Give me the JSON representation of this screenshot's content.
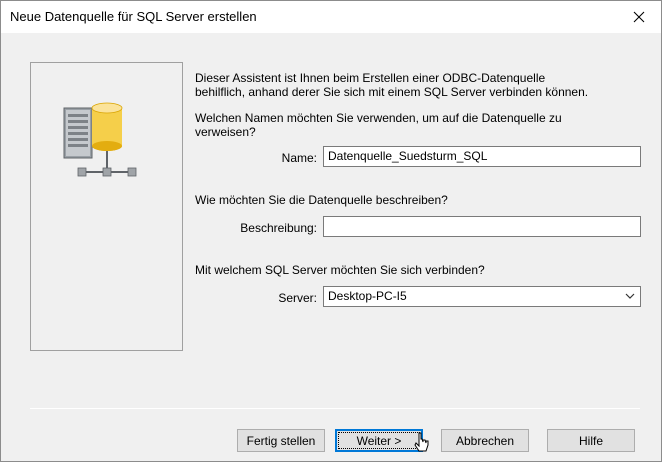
{
  "window": {
    "title": "Neue Datenquelle für SQL Server erstellen"
  },
  "intro": {
    "line1": "Dieser Assistent ist Ihnen beim Erstellen einer ODBC-Datenquelle",
    "line2": "behilflich, anhand derer Sie sich mit einem SQL Server verbinden können."
  },
  "name_section": {
    "question_line1": "Welchen Namen möchten Sie verwenden, um auf die Datenquelle zu",
    "question_line2": "verweisen?",
    "label": "Name:",
    "value": "Datenquelle_Suedsturm_SQL"
  },
  "description_section": {
    "question": "Wie möchten Sie die Datenquelle beschreiben?",
    "label": "Beschreibung:",
    "value": ""
  },
  "server_section": {
    "question": "Mit welchem SQL Server möchten Sie sich verbinden?",
    "label": "Server:",
    "value": "Desktop-PC-I5"
  },
  "buttons": {
    "finish": "Fertig stellen",
    "next": "Weiter >",
    "cancel": "Abbrechen",
    "help": "Hilfe"
  },
  "colors": {
    "accent": "#0078d7",
    "window_bg": "#f0f0f0"
  },
  "icons": [
    "close-icon",
    "database-server-icon",
    "chevron-down-icon",
    "mouse-cursor-icon"
  ]
}
